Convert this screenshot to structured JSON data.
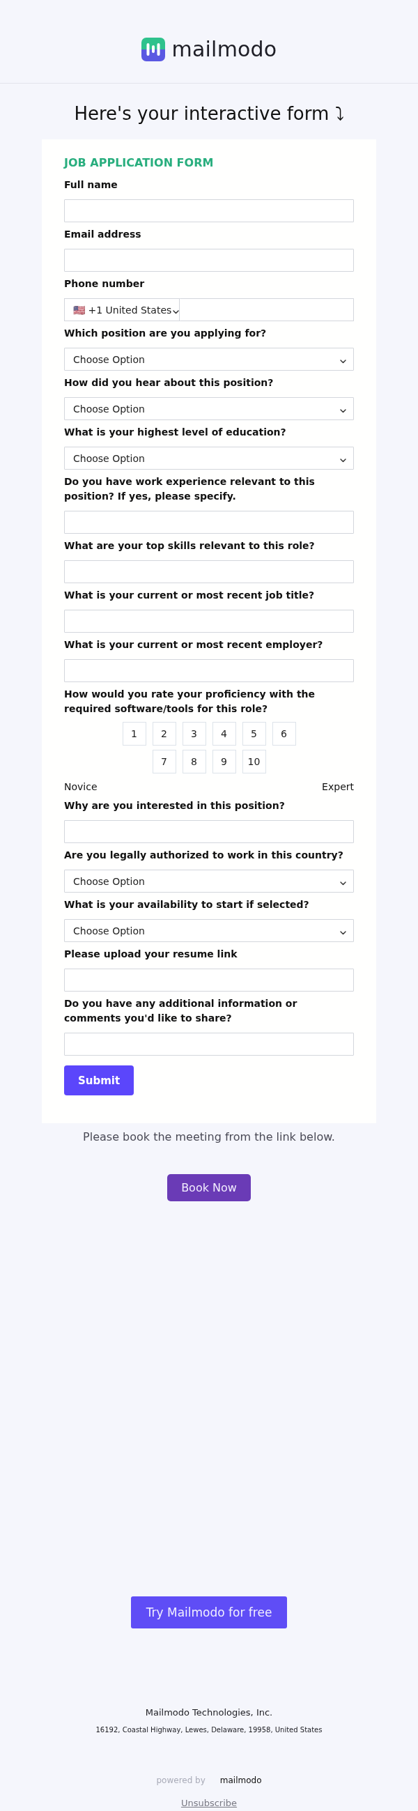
{
  "header": {
    "logo_text": "mailmodo"
  },
  "heading": "Here's your interactive form ⤵",
  "form": {
    "title": "JOB APPLICATION FORM",
    "fields": [
      {
        "kind": "text",
        "label": "Full name"
      },
      {
        "kind": "text",
        "label": "Email address"
      },
      {
        "kind": "phone",
        "label": "Phone number",
        "country": "🇺🇸 +1 United States"
      },
      {
        "kind": "select",
        "label": "Which position are you applying for?",
        "value": "Choose Option"
      },
      {
        "kind": "select",
        "label": "How did you hear about this position?",
        "value": "Choose Option"
      },
      {
        "kind": "select",
        "label": "What is your highest level of education?",
        "value": "Choose Option"
      },
      {
        "kind": "text",
        "label": "Do you have work experience relevant to this position? If yes, please specify."
      },
      {
        "kind": "text",
        "label": "What are your top skills relevant to this role?"
      },
      {
        "kind": "text",
        "label": "What is your current or most recent job title?"
      },
      {
        "kind": "text",
        "label": "What is your current or most recent employer?"
      },
      {
        "kind": "rating",
        "label": "How would you rate your proficiency with the required software/tools for this role?",
        "options": [
          {
            "label": "1",
            "selected": false
          },
          {
            "label": "2",
            "selected": false
          },
          {
            "label": "3",
            "selected": false
          },
          {
            "label": "4",
            "selected": false
          },
          {
            "label": "5",
            "selected": false
          },
          {
            "label": "6",
            "selected": false
          },
          {
            "label": "7",
            "selected": false
          },
          {
            "label": "8",
            "selected": false
          },
          {
            "label": "9",
            "selected": false
          },
          {
            "label": "10",
            "selected": false
          }
        ],
        "min_label": "Novice",
        "max_label": "Expert"
      },
      {
        "kind": "text",
        "label": "Why are you interested in this position?"
      },
      {
        "kind": "select",
        "label": "Are you legally authorized to work in this country?",
        "value": "Choose Option"
      },
      {
        "kind": "select",
        "label": "What is your availability to start if selected?",
        "value": "Choose Option"
      },
      {
        "kind": "text",
        "label": "Please upload your resume link"
      },
      {
        "kind": "text",
        "label": "Do you have any additional information or comments you'd like to share?"
      }
    ],
    "submit": "Submit"
  },
  "booking": {
    "text": "Please book the meeting from the link below.",
    "button": "Book Now"
  },
  "cta": "Try Mailmodo for free",
  "footer": {
    "company": "Mailmodo Technologies, Inc.",
    "address": "16192, Coastal Highway, Lewes, Delaware, 19958, United States",
    "powered_by": "powered by",
    "powered_logo": "mailmodo",
    "unsubscribe": "Unsubscribe"
  }
}
